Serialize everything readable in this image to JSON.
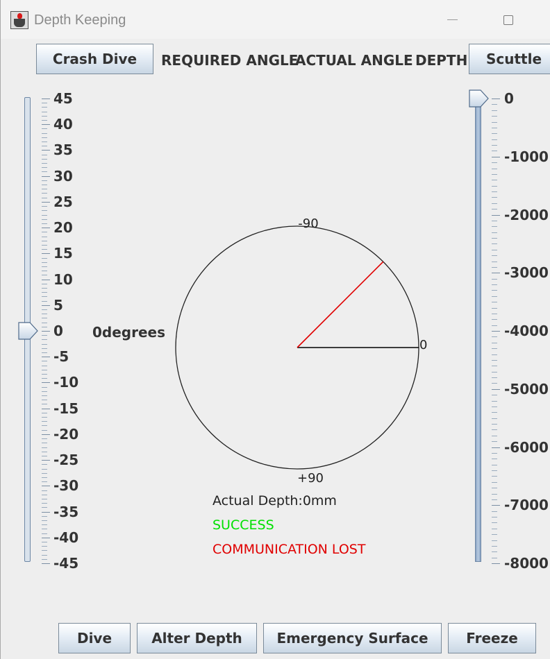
{
  "window": {
    "title": "Depth Keeping",
    "app_icon": "java-cup-icon",
    "controls": [
      "minimize-icon",
      "maximize-icon"
    ]
  },
  "header": {
    "crash_dive_label": "Crash Dive",
    "required_angle_label": "REQUIRED ANGLE",
    "actual_angle_label": "ACTUAL ANGLE",
    "depth_label": "DEPTH",
    "scuttle_label": "Scuttle"
  },
  "angle_slider": {
    "labels": [
      "45",
      "40",
      "35",
      "30",
      "25",
      "20",
      "15",
      "10",
      "5",
      "0",
      "-5",
      "-10",
      "-15",
      "-20",
      "-25",
      "-30",
      "-35",
      "-40",
      "-45"
    ],
    "min": -45,
    "max": 45,
    "value": 0
  },
  "depth_slider": {
    "labels": [
      "0",
      "-1000",
      "-2000",
      "-3000",
      "-4000",
      "-5000",
      "-6000",
      "-7000",
      "-8000"
    ],
    "min": -8000,
    "max": 0,
    "value": 0
  },
  "angle_readout": "0degrees",
  "dial": {
    "label_top": "-90",
    "label_right": "0",
    "label_bottom": "+90",
    "required_angle_deg": -45,
    "actual_angle_deg": 0,
    "needle_color": "#e00000",
    "reference_color": "#000000"
  },
  "status": {
    "depth_text": "Actual Depth:0mm",
    "success_text": "SUCCESS",
    "success_color": "#00e000",
    "comm_text": "COMMUNICATION LOST",
    "comm_color": "#e00000"
  },
  "footer": {
    "dive_label": "Dive",
    "alter_depth_label": "Alter Depth",
    "emergency_surface_label": "Emergency Surface",
    "freeze_label": "Freeze"
  }
}
